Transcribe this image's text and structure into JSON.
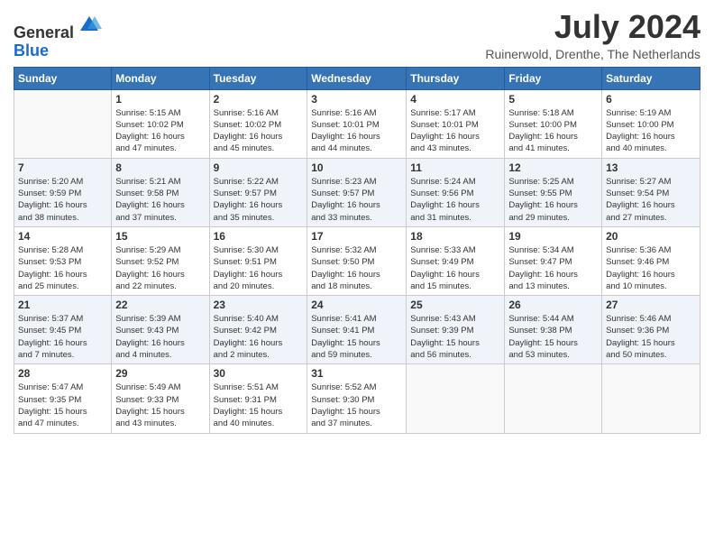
{
  "header": {
    "logo": {
      "line1": "General",
      "line2": "Blue"
    },
    "title": "July 2024",
    "location": "Ruinerwold, Drenthe, The Netherlands"
  },
  "calendar": {
    "days_of_week": [
      "Sunday",
      "Monday",
      "Tuesday",
      "Wednesday",
      "Thursday",
      "Friday",
      "Saturday"
    ],
    "weeks": [
      [
        {
          "day": "",
          "info": ""
        },
        {
          "day": "1",
          "info": "Sunrise: 5:15 AM\nSunset: 10:02 PM\nDaylight: 16 hours\nand 47 minutes."
        },
        {
          "day": "2",
          "info": "Sunrise: 5:16 AM\nSunset: 10:02 PM\nDaylight: 16 hours\nand 45 minutes."
        },
        {
          "day": "3",
          "info": "Sunrise: 5:16 AM\nSunset: 10:01 PM\nDaylight: 16 hours\nand 44 minutes."
        },
        {
          "day": "4",
          "info": "Sunrise: 5:17 AM\nSunset: 10:01 PM\nDaylight: 16 hours\nand 43 minutes."
        },
        {
          "day": "5",
          "info": "Sunrise: 5:18 AM\nSunset: 10:00 PM\nDaylight: 16 hours\nand 41 minutes."
        },
        {
          "day": "6",
          "info": "Sunrise: 5:19 AM\nSunset: 10:00 PM\nDaylight: 16 hours\nand 40 minutes."
        }
      ],
      [
        {
          "day": "7",
          "info": "Sunrise: 5:20 AM\nSunset: 9:59 PM\nDaylight: 16 hours\nand 38 minutes."
        },
        {
          "day": "8",
          "info": "Sunrise: 5:21 AM\nSunset: 9:58 PM\nDaylight: 16 hours\nand 37 minutes."
        },
        {
          "day": "9",
          "info": "Sunrise: 5:22 AM\nSunset: 9:57 PM\nDaylight: 16 hours\nand 35 minutes."
        },
        {
          "day": "10",
          "info": "Sunrise: 5:23 AM\nSunset: 9:57 PM\nDaylight: 16 hours\nand 33 minutes."
        },
        {
          "day": "11",
          "info": "Sunrise: 5:24 AM\nSunset: 9:56 PM\nDaylight: 16 hours\nand 31 minutes."
        },
        {
          "day": "12",
          "info": "Sunrise: 5:25 AM\nSunset: 9:55 PM\nDaylight: 16 hours\nand 29 minutes."
        },
        {
          "day": "13",
          "info": "Sunrise: 5:27 AM\nSunset: 9:54 PM\nDaylight: 16 hours\nand 27 minutes."
        }
      ],
      [
        {
          "day": "14",
          "info": "Sunrise: 5:28 AM\nSunset: 9:53 PM\nDaylight: 16 hours\nand 25 minutes."
        },
        {
          "day": "15",
          "info": "Sunrise: 5:29 AM\nSunset: 9:52 PM\nDaylight: 16 hours\nand 22 minutes."
        },
        {
          "day": "16",
          "info": "Sunrise: 5:30 AM\nSunset: 9:51 PM\nDaylight: 16 hours\nand 20 minutes."
        },
        {
          "day": "17",
          "info": "Sunrise: 5:32 AM\nSunset: 9:50 PM\nDaylight: 16 hours\nand 18 minutes."
        },
        {
          "day": "18",
          "info": "Sunrise: 5:33 AM\nSunset: 9:49 PM\nDaylight: 16 hours\nand 15 minutes."
        },
        {
          "day": "19",
          "info": "Sunrise: 5:34 AM\nSunset: 9:47 PM\nDaylight: 16 hours\nand 13 minutes."
        },
        {
          "day": "20",
          "info": "Sunrise: 5:36 AM\nSunset: 9:46 PM\nDaylight: 16 hours\nand 10 minutes."
        }
      ],
      [
        {
          "day": "21",
          "info": "Sunrise: 5:37 AM\nSunset: 9:45 PM\nDaylight: 16 hours\nand 7 minutes."
        },
        {
          "day": "22",
          "info": "Sunrise: 5:39 AM\nSunset: 9:43 PM\nDaylight: 16 hours\nand 4 minutes."
        },
        {
          "day": "23",
          "info": "Sunrise: 5:40 AM\nSunset: 9:42 PM\nDaylight: 16 hours\nand 2 minutes."
        },
        {
          "day": "24",
          "info": "Sunrise: 5:41 AM\nSunset: 9:41 PM\nDaylight: 15 hours\nand 59 minutes."
        },
        {
          "day": "25",
          "info": "Sunrise: 5:43 AM\nSunset: 9:39 PM\nDaylight: 15 hours\nand 56 minutes."
        },
        {
          "day": "26",
          "info": "Sunrise: 5:44 AM\nSunset: 9:38 PM\nDaylight: 15 hours\nand 53 minutes."
        },
        {
          "day": "27",
          "info": "Sunrise: 5:46 AM\nSunset: 9:36 PM\nDaylight: 15 hours\nand 50 minutes."
        }
      ],
      [
        {
          "day": "28",
          "info": "Sunrise: 5:47 AM\nSunset: 9:35 PM\nDaylight: 15 hours\nand 47 minutes."
        },
        {
          "day": "29",
          "info": "Sunrise: 5:49 AM\nSunset: 9:33 PM\nDaylight: 15 hours\nand 43 minutes."
        },
        {
          "day": "30",
          "info": "Sunrise: 5:51 AM\nSunset: 9:31 PM\nDaylight: 15 hours\nand 40 minutes."
        },
        {
          "day": "31",
          "info": "Sunrise: 5:52 AM\nSunset: 9:30 PM\nDaylight: 15 hours\nand 37 minutes."
        },
        {
          "day": "",
          "info": ""
        },
        {
          "day": "",
          "info": ""
        },
        {
          "day": "",
          "info": ""
        }
      ]
    ]
  }
}
